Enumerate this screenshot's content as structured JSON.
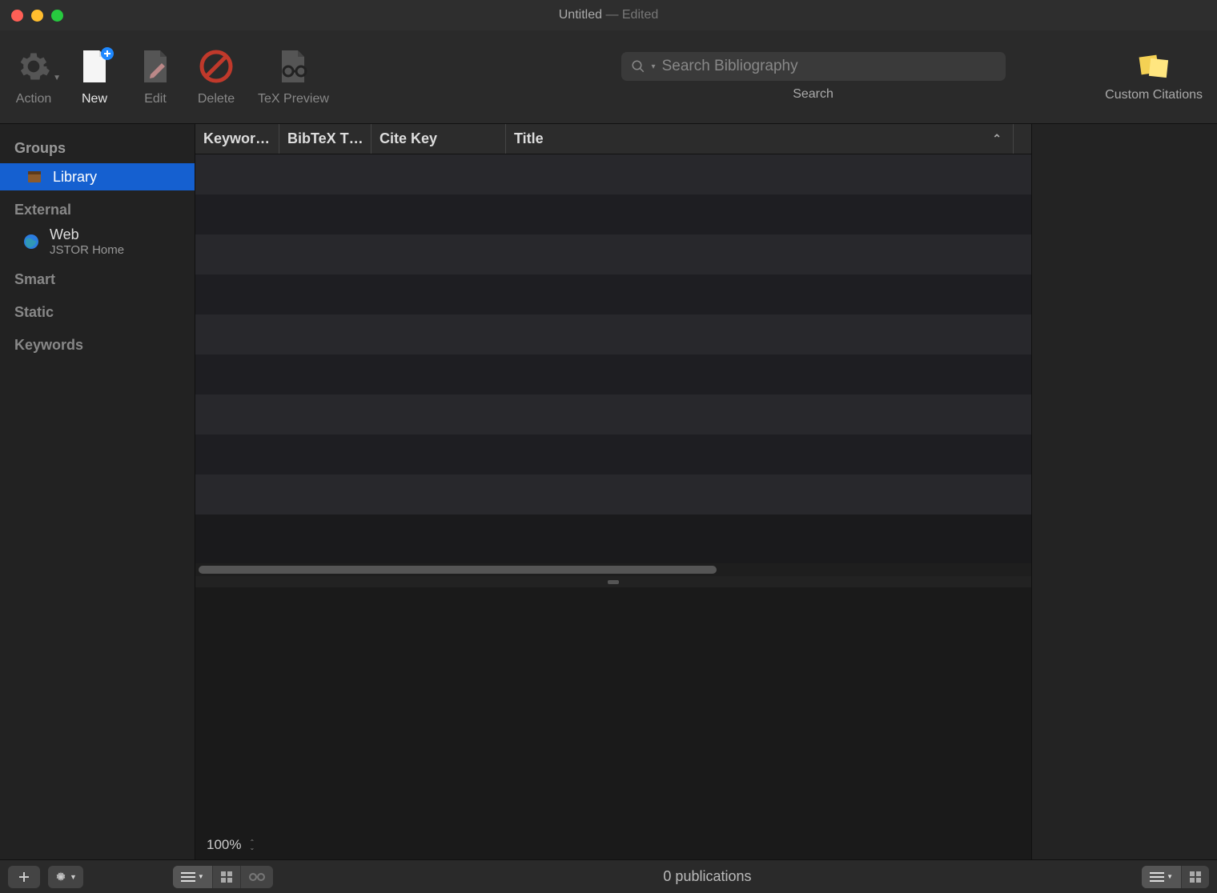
{
  "window": {
    "title": "Untitled",
    "edited_suffix": " — Edited"
  },
  "toolbar": {
    "action": "Action",
    "new": "New",
    "edit": "Edit",
    "delete": "Delete",
    "tex_preview": "TeX Preview",
    "search_label": "Search",
    "search_placeholder": "Search Bibliography",
    "custom_citations": "Custom Citations"
  },
  "sidebar": {
    "groups_header": "Groups",
    "library": "Library",
    "external_header": "External",
    "web_label": "Web",
    "web_detail": "JSTOR Home",
    "smart_header": "Smart",
    "static_header": "Static",
    "keywords_header": "Keywords"
  },
  "columns": {
    "keywords": "Keywor…",
    "bibtex_type": "BibTeX T…",
    "cite_key": "Cite Key",
    "title": "Title"
  },
  "preview": {
    "zoom": "100%"
  },
  "status": {
    "count": "0 publications"
  }
}
